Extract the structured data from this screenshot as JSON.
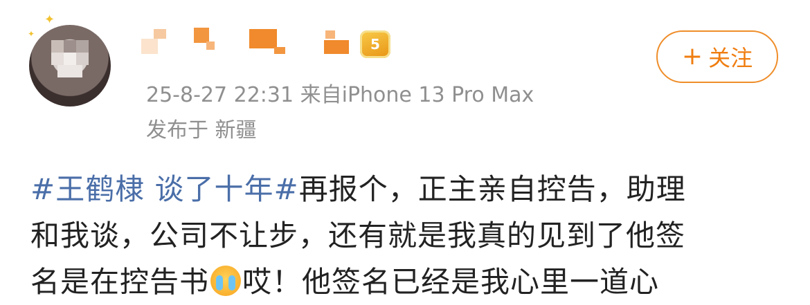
{
  "post": {
    "time_source": "25-8-27 22:31  来自iPhone 13 Pro Max",
    "location": "发布于 新疆",
    "follow_label": "关注",
    "follow_plus": "+",
    "vip_level": "5",
    "content": {
      "topic1": "#王鹤棣 谈了十年#",
      "line1_rest": "再报个，正主亲自控告，助理",
      "line2": "和我谈，公司不让步，还有就是我真的见到了他签",
      "line3_before": "名是在控告书",
      "line3_after": "哎！他签名已经是我心里一道心"
    }
  },
  "icons": {
    "avatar": "avatar-blurred",
    "vip": "vip-crown-badge",
    "emoji": "crying-face-emoji"
  },
  "colors": {
    "accent": "#ef7d10",
    "topic": "#4a6ea8",
    "meta": "#8f8f8f",
    "text": "#222222",
    "username_mosaic": "#f08a2c"
  }
}
